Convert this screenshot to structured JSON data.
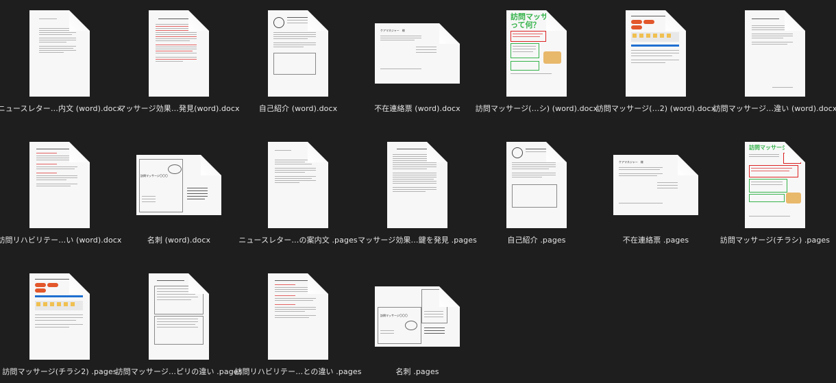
{
  "files": [
    {
      "name": "ニュースレター…内文 (word).docx"
    },
    {
      "name": "マッサージ効果…発見(word).docx"
    },
    {
      "name": "自己紹介 (word).docx"
    },
    {
      "name": "不在連絡票 (word).docx"
    },
    {
      "name": "訪問マッサージ(…シ) (word).docx"
    },
    {
      "name": "訪問マッサージ(…2) (word).docx"
    },
    {
      "name": "訪問マッサージ…違い (word).docx"
    },
    {
      "name": "訪問リハビリテー…い (word).docx"
    },
    {
      "name": "名刺 (word).docx"
    },
    {
      "name": "ニュースレター…の案内文 .pages"
    },
    {
      "name": "マッサージ効果…鍵を発見 .pages"
    },
    {
      "name": "自己紹介 .pages"
    },
    {
      "name": "不在連絡票 .pages"
    },
    {
      "name": "訪問マッサージ(チラシ) .pages"
    },
    {
      "name": "訪問マッサージ(チラシ2) .pages"
    },
    {
      "name": "訪問マッサージ…ピリの違い .pages"
    },
    {
      "name": "訪問リハビリテー…との違い .pages"
    },
    {
      "name": "名刺 .pages"
    }
  ],
  "icons": {
    "document": "document-icon",
    "accent_red": "#d22222",
    "accent_green": "#34b34a",
    "background": "#1e1e1e",
    "label_color": "#e6e6e6"
  },
  "thumb_text": {
    "flyer_title_line1": "訪問マッサージ",
    "flyer_title_line2": "って何？",
    "flyer_small_title": "訪問マッサージ",
    "card_name": "訪問マッサージ〇〇〇",
    "absence_heading": "ケアマネジャー　様"
  }
}
